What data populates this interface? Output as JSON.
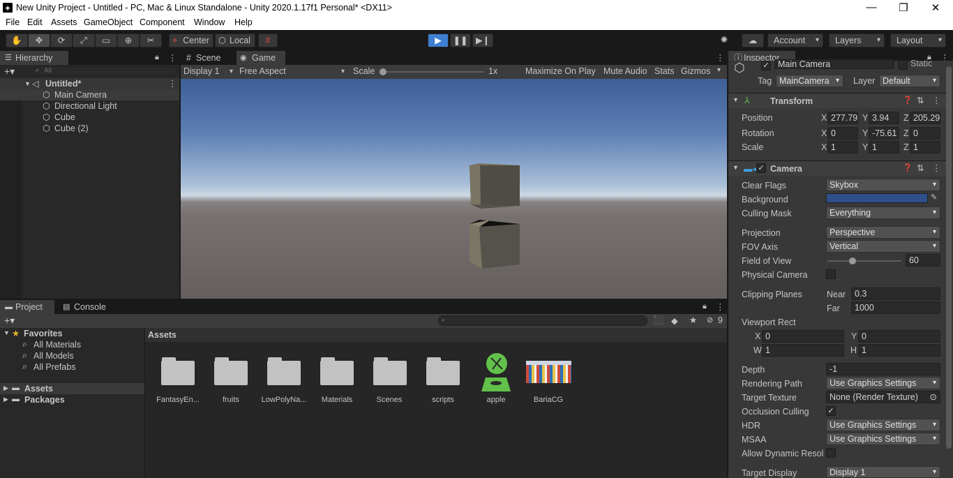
{
  "window": {
    "title": "New Unity Project - Untitled - PC, Mac & Linux Standalone - Unity 2020.1.17f1 Personal* <DX11>",
    "minimize": "—",
    "restore": "❐",
    "close": "✕"
  },
  "menu": [
    "File",
    "Edit",
    "Assets",
    "GameObject",
    "Component",
    "Window",
    "Help"
  ],
  "toolbar": {
    "pivot": "Center",
    "space": "Local",
    "account": "Account",
    "layers": "Layers",
    "layout": "Layout"
  },
  "hierarchy": {
    "tab": "Hierarchy",
    "search_placeholder": "All",
    "scene": "Untitled*",
    "items": [
      "Main Camera",
      "Directional Light",
      "Cube",
      "Cube (2)"
    ]
  },
  "game_view": {
    "tabs": [
      "Scene",
      "Game"
    ],
    "display": "Display 1",
    "aspect": "Free Aspect",
    "scale_label": "Scale",
    "scale_value": "1x",
    "maximize": "Maximize On Play",
    "mute": "Mute Audio",
    "stats": "Stats",
    "gizmos": "Gizmos"
  },
  "project": {
    "tabs": [
      "Project",
      "Console"
    ],
    "hidden_count": "9",
    "favorites": "Favorites",
    "favorite_items": [
      "All Materials",
      "All Models",
      "All Prefabs"
    ],
    "roots": [
      "Assets",
      "Packages"
    ],
    "breadcrumb": "Assets",
    "assets": [
      {
        "name": "FantasyEn...",
        "type": "folder"
      },
      {
        "name": "fruits",
        "type": "folder"
      },
      {
        "name": "LowPolyNa...",
        "type": "folder"
      },
      {
        "name": "Materials",
        "type": "folder"
      },
      {
        "name": "Scenes",
        "type": "folder"
      },
      {
        "name": "scripts",
        "type": "folder"
      },
      {
        "name": "apple",
        "type": "model"
      },
      {
        "name": "BariaCG",
        "type": "image"
      }
    ]
  },
  "inspector": {
    "tab": "Inspector",
    "object_name": "Main Camera",
    "static": "Static",
    "tag_label": "Tag",
    "tag_value": "MainCamera",
    "layer_label": "Layer",
    "layer_value": "Default",
    "transform": {
      "title": "Transform",
      "position_label": "Position",
      "rotation_label": "Rotation",
      "scale_label": "Scale",
      "position": {
        "x": "277.79",
        "y": "3.94",
        "z": "205.29"
      },
      "rotation": {
        "x": "0",
        "y": "-75.61",
        "z": "0"
      },
      "scale": {
        "x": "1",
        "y": "1",
        "z": "1"
      }
    },
    "camera": {
      "title": "Camera",
      "clear_flags_label": "Clear Flags",
      "clear_flags": "Skybox",
      "background_label": "Background",
      "background_color": "#2f4f8a",
      "culling_mask_label": "Culling Mask",
      "culling_mask": "Everything",
      "projection_label": "Projection",
      "projection": "Perspective",
      "fov_axis_label": "FOV Axis",
      "fov_axis": "Vertical",
      "fov_label": "Field of View",
      "fov": "60",
      "physical_label": "Physical Camera",
      "clipping_label": "Clipping Planes",
      "near_label": "Near",
      "near": "0.3",
      "far_label": "Far",
      "far": "1000",
      "viewport_label": "Viewport Rect",
      "vx": "0",
      "vy": "0",
      "vw": "1",
      "vh": "1",
      "depth_label": "Depth",
      "depth": "-1",
      "rendering_path_label": "Rendering Path",
      "rendering_path": "Use Graphics Settings",
      "target_texture_label": "Target Texture",
      "target_texture": "None (Render Texture)",
      "occlusion_label": "Occlusion Culling",
      "hdr_label": "HDR",
      "hdr": "Use Graphics Settings",
      "msaa_label": "MSAA",
      "msaa": "Use Graphics Settings",
      "dynamic_label": "Allow Dynamic Resol",
      "target_display_label": "Target Display",
      "target_display": "Display 1"
    }
  }
}
